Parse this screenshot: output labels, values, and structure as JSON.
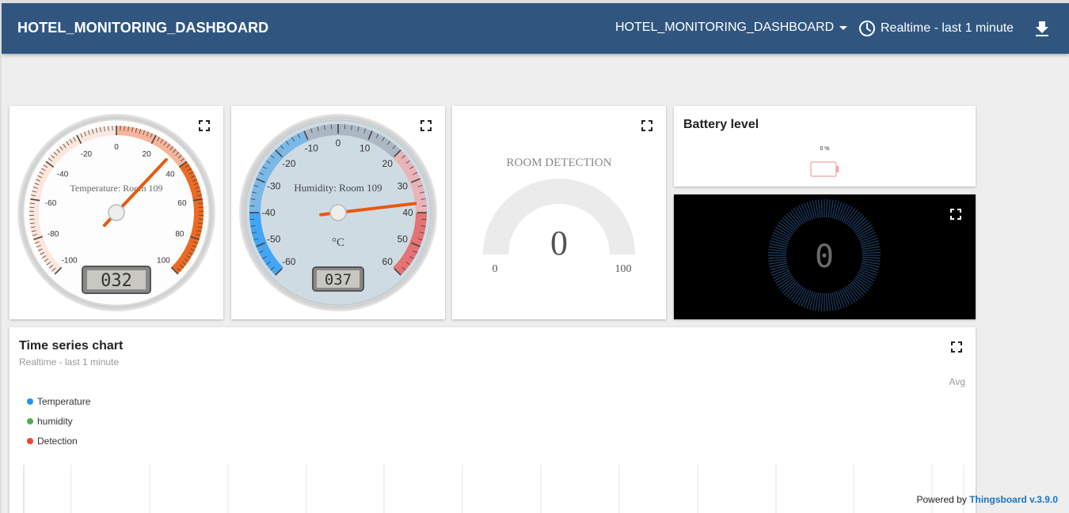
{
  "header": {
    "title": "HOTEL_MONITORING_DASHBOARD",
    "dashboard_select": "HOTEL_MONITORING_DASHBOARD",
    "timewindow": "Realtime - last 1 minute"
  },
  "temperature_gauge": {
    "title": "Temperature: Room 109",
    "value": 32,
    "display": "032",
    "min": -100,
    "max": 100,
    "ticks": [
      "-100",
      "-80",
      "-60",
      "-40",
      "-20",
      "0",
      "20",
      "40",
      "60",
      "80",
      "100"
    ]
  },
  "humidity_gauge": {
    "title": "Humidity: Room 109",
    "unit": "°C",
    "value": 37,
    "display": "037",
    "min": -60,
    "max": 60,
    "ticks": [
      "-60",
      "-50",
      "-40",
      "-30",
      "-20",
      "-10",
      "0",
      "10",
      "20",
      "30",
      "40",
      "50",
      "60"
    ]
  },
  "room_detection": {
    "title": "ROOM DETECTION",
    "value": "0",
    "min": "0",
    "max": "100"
  },
  "battery": {
    "title": "Battery level",
    "percent_label": "0 %",
    "level": 0
  },
  "digital_gauge": {
    "value": "0"
  },
  "timeseries": {
    "title": "Time series chart",
    "subtitle": "Realtime - last 1 minute",
    "avg_label": "Avg",
    "legend": [
      {
        "label": "Temperature",
        "color": "#2196f3"
      },
      {
        "label": "humidity",
        "color": "#4caf50"
      },
      {
        "label": "Detection",
        "color": "#f44336"
      }
    ]
  },
  "footer": {
    "powered_by": "Powered by",
    "brand": "Thingsboard v.3.9.0"
  },
  "colors": {
    "primary": "#305680",
    "gauge_orange": "#e8590c",
    "humidity_blue": "#42a5f5",
    "humidity_red": "#e57373"
  }
}
